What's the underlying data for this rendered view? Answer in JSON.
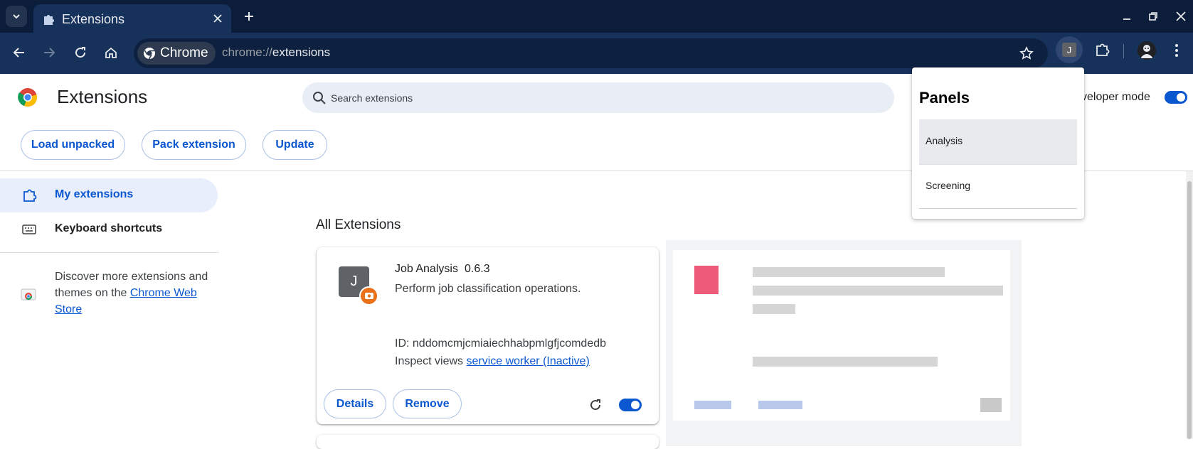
{
  "browser": {
    "tab_title": "Extensions",
    "chip_label": "Chrome",
    "url_scheme": "chrome://",
    "url_host": "extensions",
    "ext_badge_letter": "J"
  },
  "header": {
    "title": "Extensions",
    "search_placeholder": "Search extensions",
    "developer_mode_label": "veloper mode",
    "developer_mode_on": true
  },
  "actions": {
    "load_unpacked": "Load unpacked",
    "pack_extension": "Pack extension",
    "update": "Update"
  },
  "sidebar": {
    "items": [
      {
        "label": "My extensions",
        "selected": true
      },
      {
        "label": "Keyboard shortcuts",
        "selected": false
      }
    ],
    "discover_text": "Discover more extensions and themes on the ",
    "webstore_link": "Chrome Web Store"
  },
  "main": {
    "section_title": "All Extensions",
    "card": {
      "icon_letter": "J",
      "name": "Job Analysis",
      "version": "0.6.3",
      "description": "Perform job classification operations.",
      "id_text": "ID: nddomcmjcmiaiechhabpmlgfjcomdedb",
      "inspect_label": "Inspect views ",
      "inspect_link": "service worker (Inactive)",
      "details_label": "Details",
      "remove_label": "Remove",
      "enabled": true
    }
  },
  "popup": {
    "title": "Panels",
    "items": [
      "Analysis",
      "Screening"
    ],
    "highlighted": "Analysis"
  },
  "colors": {
    "titlebar": "#0b1d3a",
    "toolbar": "#16315a",
    "accent": "#0b57d0",
    "extension_badge": "#e8711a"
  },
  "icons": [
    "tab-search-icon",
    "puzzle-icon",
    "close-icon",
    "plus-icon",
    "minimize-icon",
    "restore-icon",
    "back-icon",
    "forward-icon",
    "reload-icon",
    "home-icon",
    "chrome-icon",
    "star-icon",
    "kebab-menu-icon",
    "search-icon",
    "keyboard-icon",
    "webstore-icon",
    "camera-badge-icon"
  ]
}
